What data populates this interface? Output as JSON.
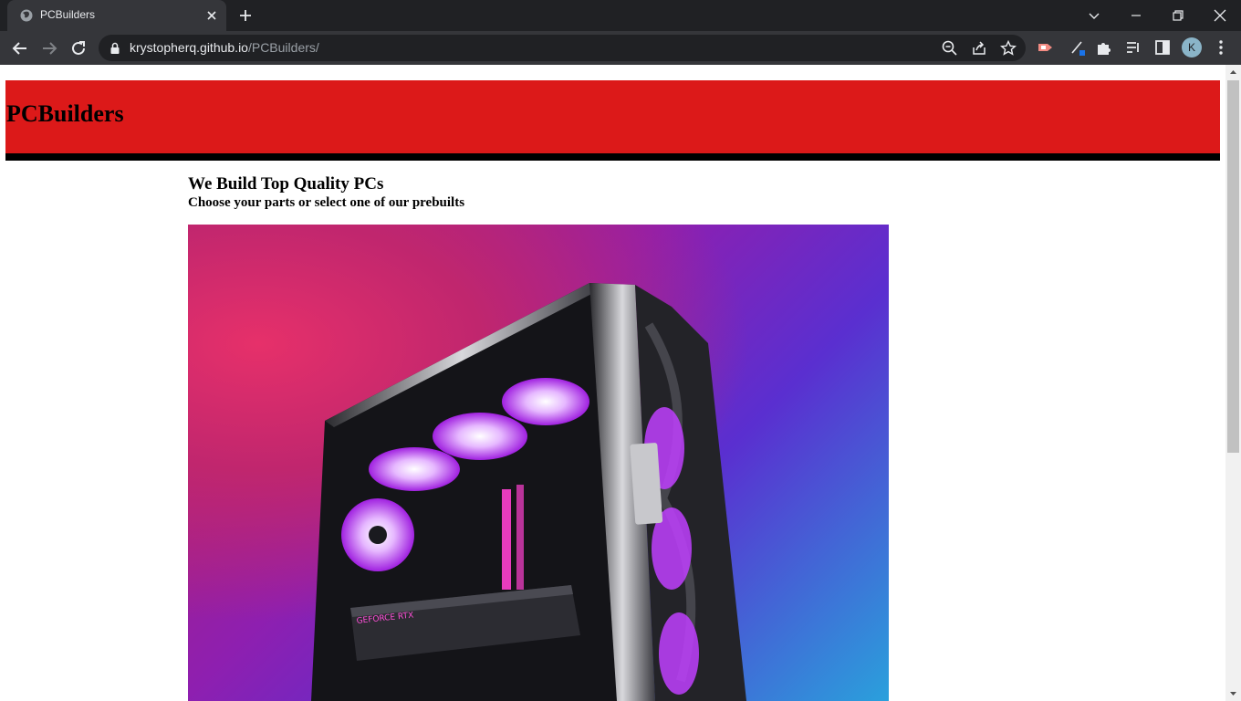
{
  "browser": {
    "tab_title": "PCBuilders",
    "url_domain": "krystopherq.github.io",
    "url_path": "/PCBuilders/",
    "profile_initial": "K"
  },
  "page": {
    "site_title": "PCBuilders",
    "headline": "We Build Top Quality PCs",
    "subheadline": "Choose your parts or select one of our prebuilts",
    "hero_image": "gaming-pc-case-hero"
  },
  "colors": {
    "header_red": "#dc1919",
    "chrome_dark": "#202124",
    "chrome_toolbar": "#35363a"
  }
}
